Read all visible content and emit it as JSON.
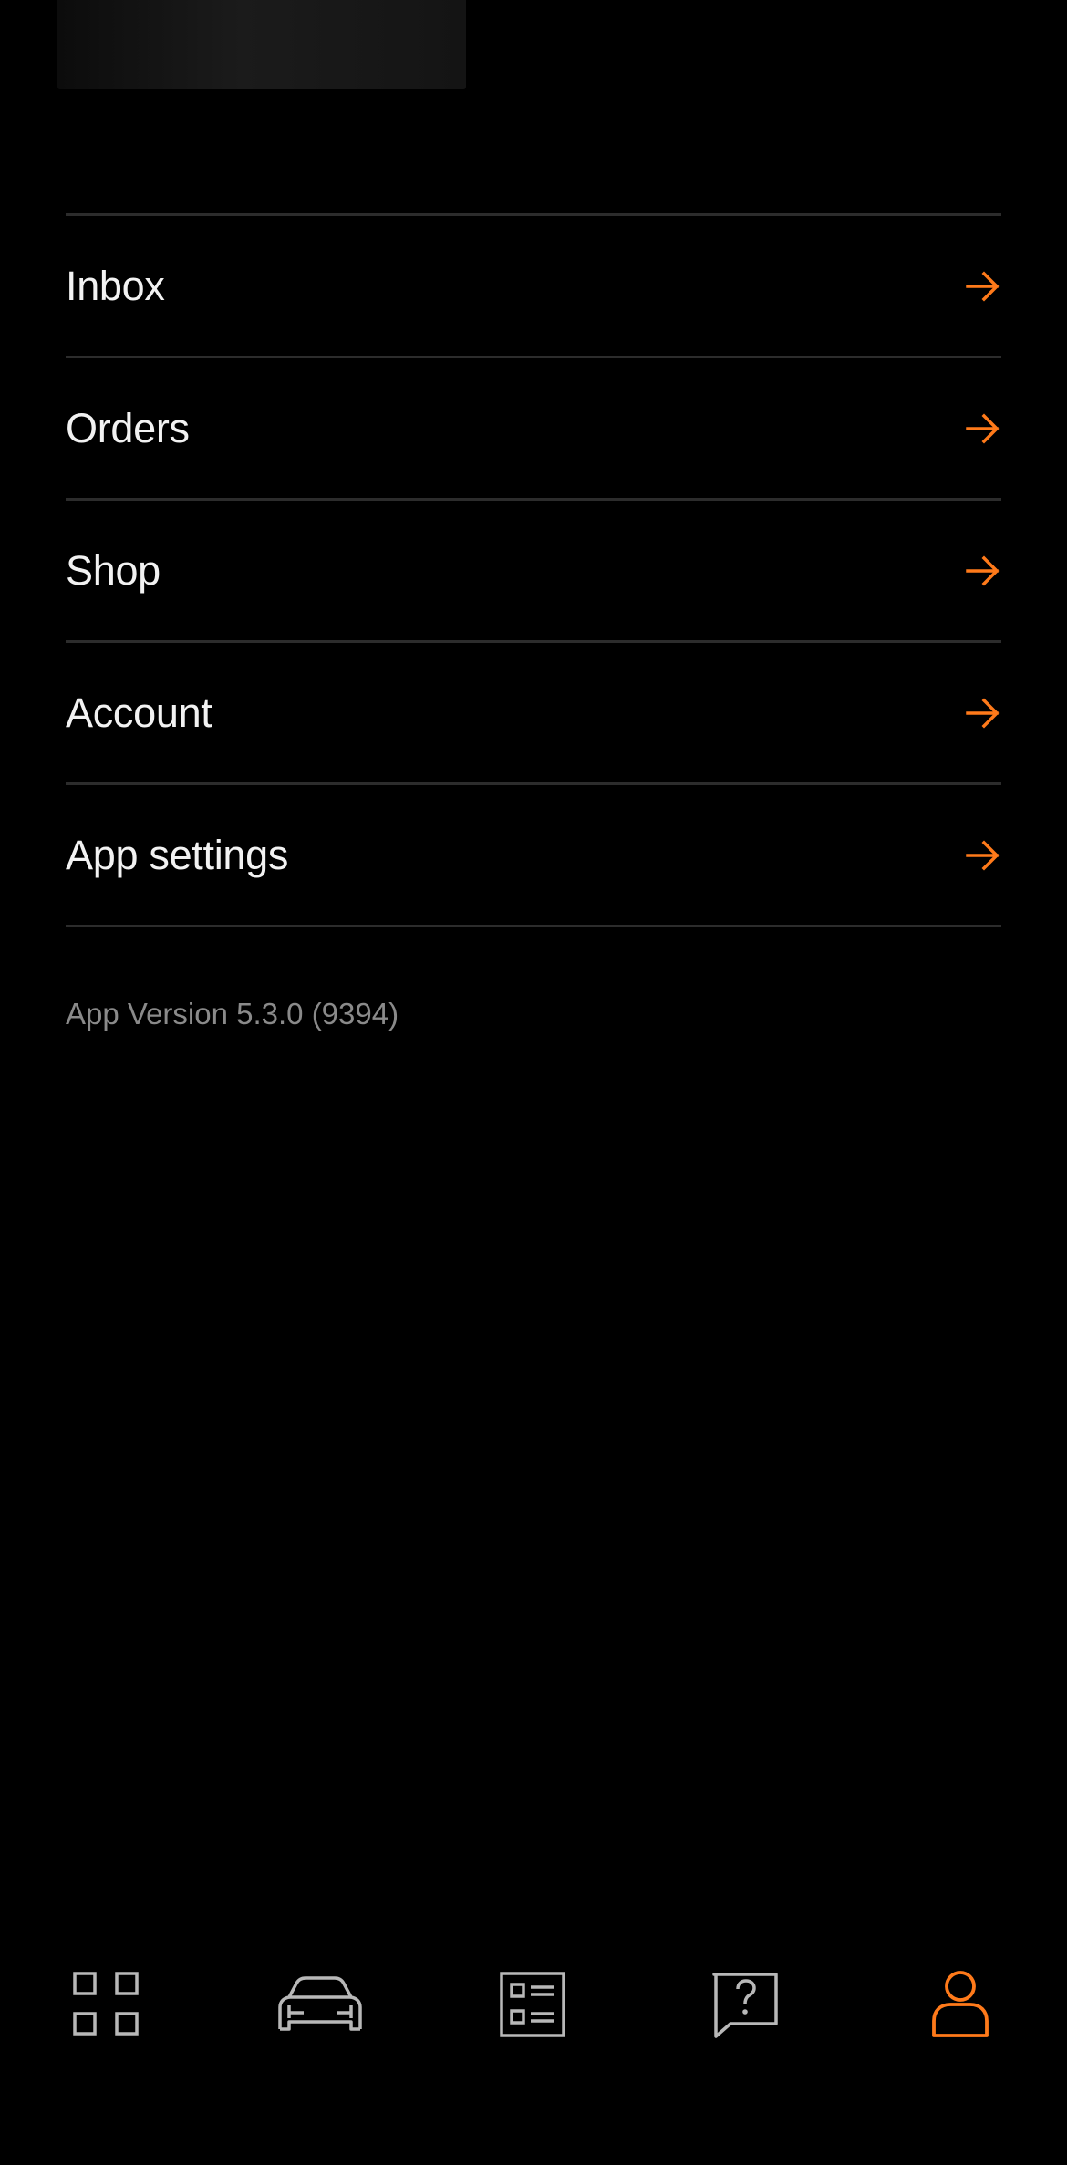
{
  "menu": {
    "items": [
      {
        "label": "Inbox",
        "icon": "arrow-right-icon"
      },
      {
        "label": "Orders",
        "icon": "arrow-right-icon"
      },
      {
        "label": "Shop",
        "icon": "arrow-right-icon"
      },
      {
        "label": "Account",
        "icon": "arrow-right-icon"
      },
      {
        "label": "App settings",
        "icon": "arrow-right-icon"
      }
    ]
  },
  "app_version": "App Version 5.3.0 (9394)",
  "tabbar": {
    "tabs": [
      {
        "icon": "grid-icon",
        "active": false
      },
      {
        "icon": "car-icon",
        "active": false
      },
      {
        "icon": "checklist-icon",
        "active": false
      },
      {
        "icon": "help-chat-icon",
        "active": false
      },
      {
        "icon": "profile-icon",
        "active": true
      }
    ]
  },
  "colors": {
    "background": "#000000",
    "accent": "#ff7a1a",
    "text": "#f2f2f2",
    "muted_text": "#8a8a8a",
    "divider": "#2c2c2c",
    "inactive_icon": "#b8b8b8"
  }
}
